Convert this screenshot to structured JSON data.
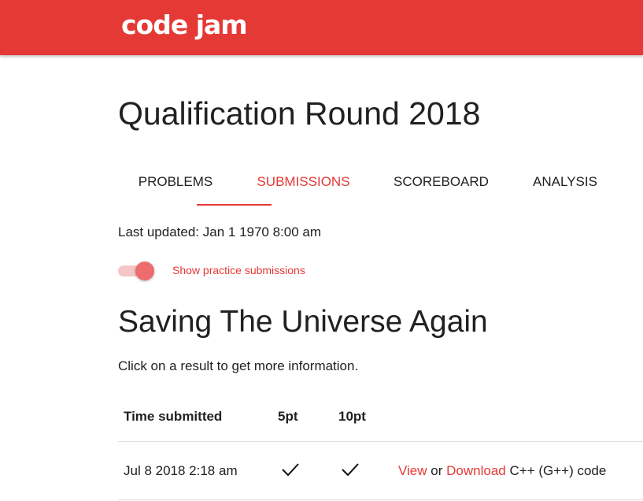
{
  "header": {
    "logo": "code jam"
  },
  "page": {
    "title": "Qualification Round 2018"
  },
  "tabs": [
    {
      "label": "PROBLEMS",
      "active": false
    },
    {
      "label": "SUBMISSIONS",
      "active": true
    },
    {
      "label": "SCOREBOARD",
      "active": false
    },
    {
      "label": "ANALYSIS",
      "active": false
    }
  ],
  "status": {
    "last_updated": "Last updated: Jan 1 1970 8:00 am"
  },
  "toggle": {
    "label": "Show practice submissions",
    "on": true
  },
  "problem": {
    "title": "Saving The Universe Again",
    "hint": "Click on a result to get more information."
  },
  "table": {
    "headers": [
      "Time submitted",
      "5pt",
      "10pt"
    ],
    "rows": [
      {
        "time": "Jul 8 2018 2:18 am",
        "result_5pt": "check-icon",
        "result_10pt": "check-icon",
        "view_label": "View",
        "or_text": "or",
        "download_label": "Download",
        "language": "C++ (G++) code"
      }
    ]
  },
  "colors": {
    "brand": "#e53935",
    "toggle_thumb": "#ee6b6e",
    "toggle_track": "#f5c6c6",
    "text": "#212121"
  }
}
